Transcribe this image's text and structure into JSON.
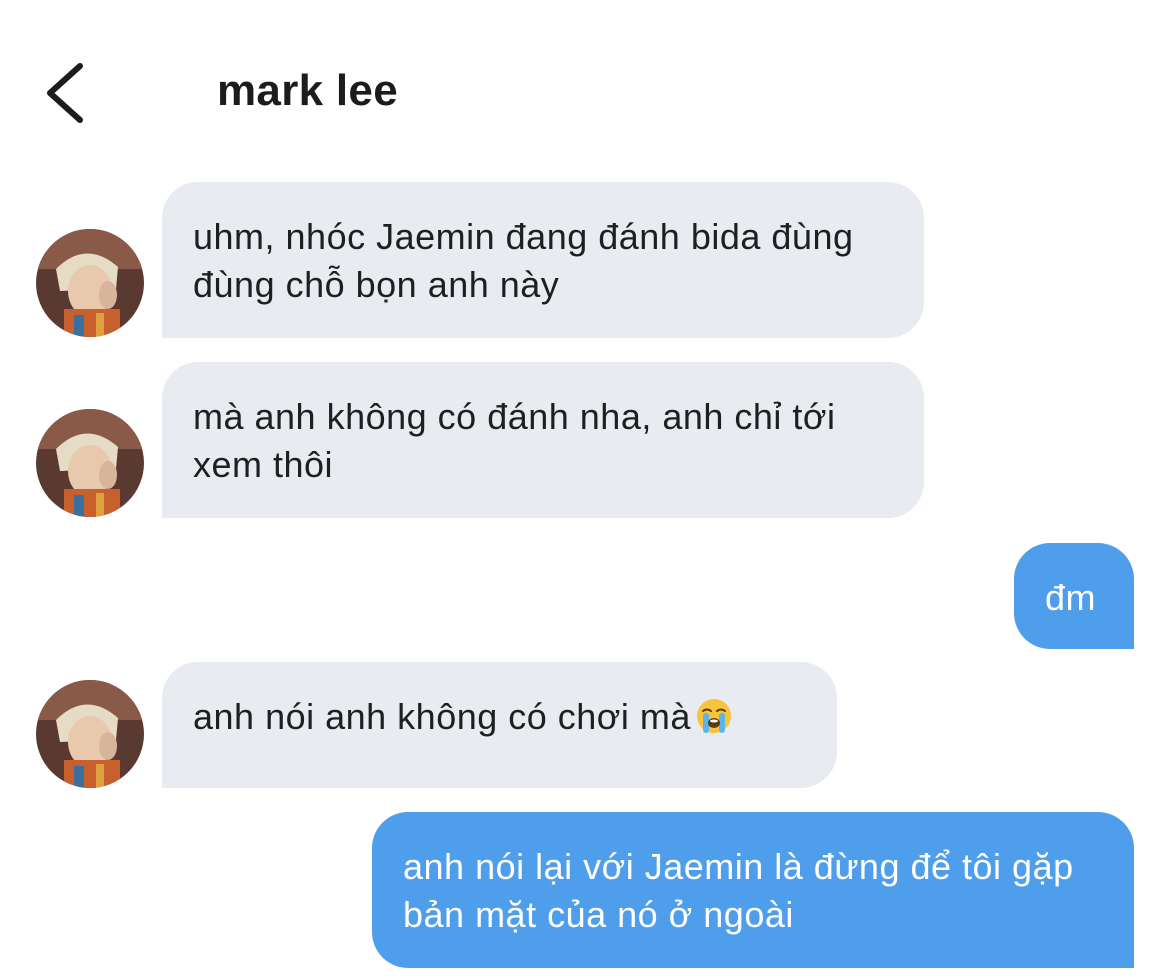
{
  "header": {
    "back_icon": "chevron-left-icon",
    "contact_name": "mark lee"
  },
  "messages": [
    {
      "direction": "incoming",
      "text": "uhm, nhóc Jaemin đang đánh bida đùng đùng chỗ bọn anh này"
    },
    {
      "direction": "incoming",
      "text": "mà anh không có đánh nha, anh chỉ tới xem thôi"
    },
    {
      "direction": "outgoing",
      "text": "đm"
    },
    {
      "direction": "incoming",
      "text": "anh nói anh không có chơi mà",
      "emoji": "loudly-crying-face"
    },
    {
      "direction": "outgoing",
      "text": "anh nói lại với Jaemin là đừng để tôi gặp bản mặt của nó ở ngoài"
    }
  ],
  "colors": {
    "incoming_bubble": "#e8ebef",
    "outgoing_bubble": "#4f9eec",
    "text_dark": "#1f1f22",
    "text_light": "#ffffff"
  }
}
